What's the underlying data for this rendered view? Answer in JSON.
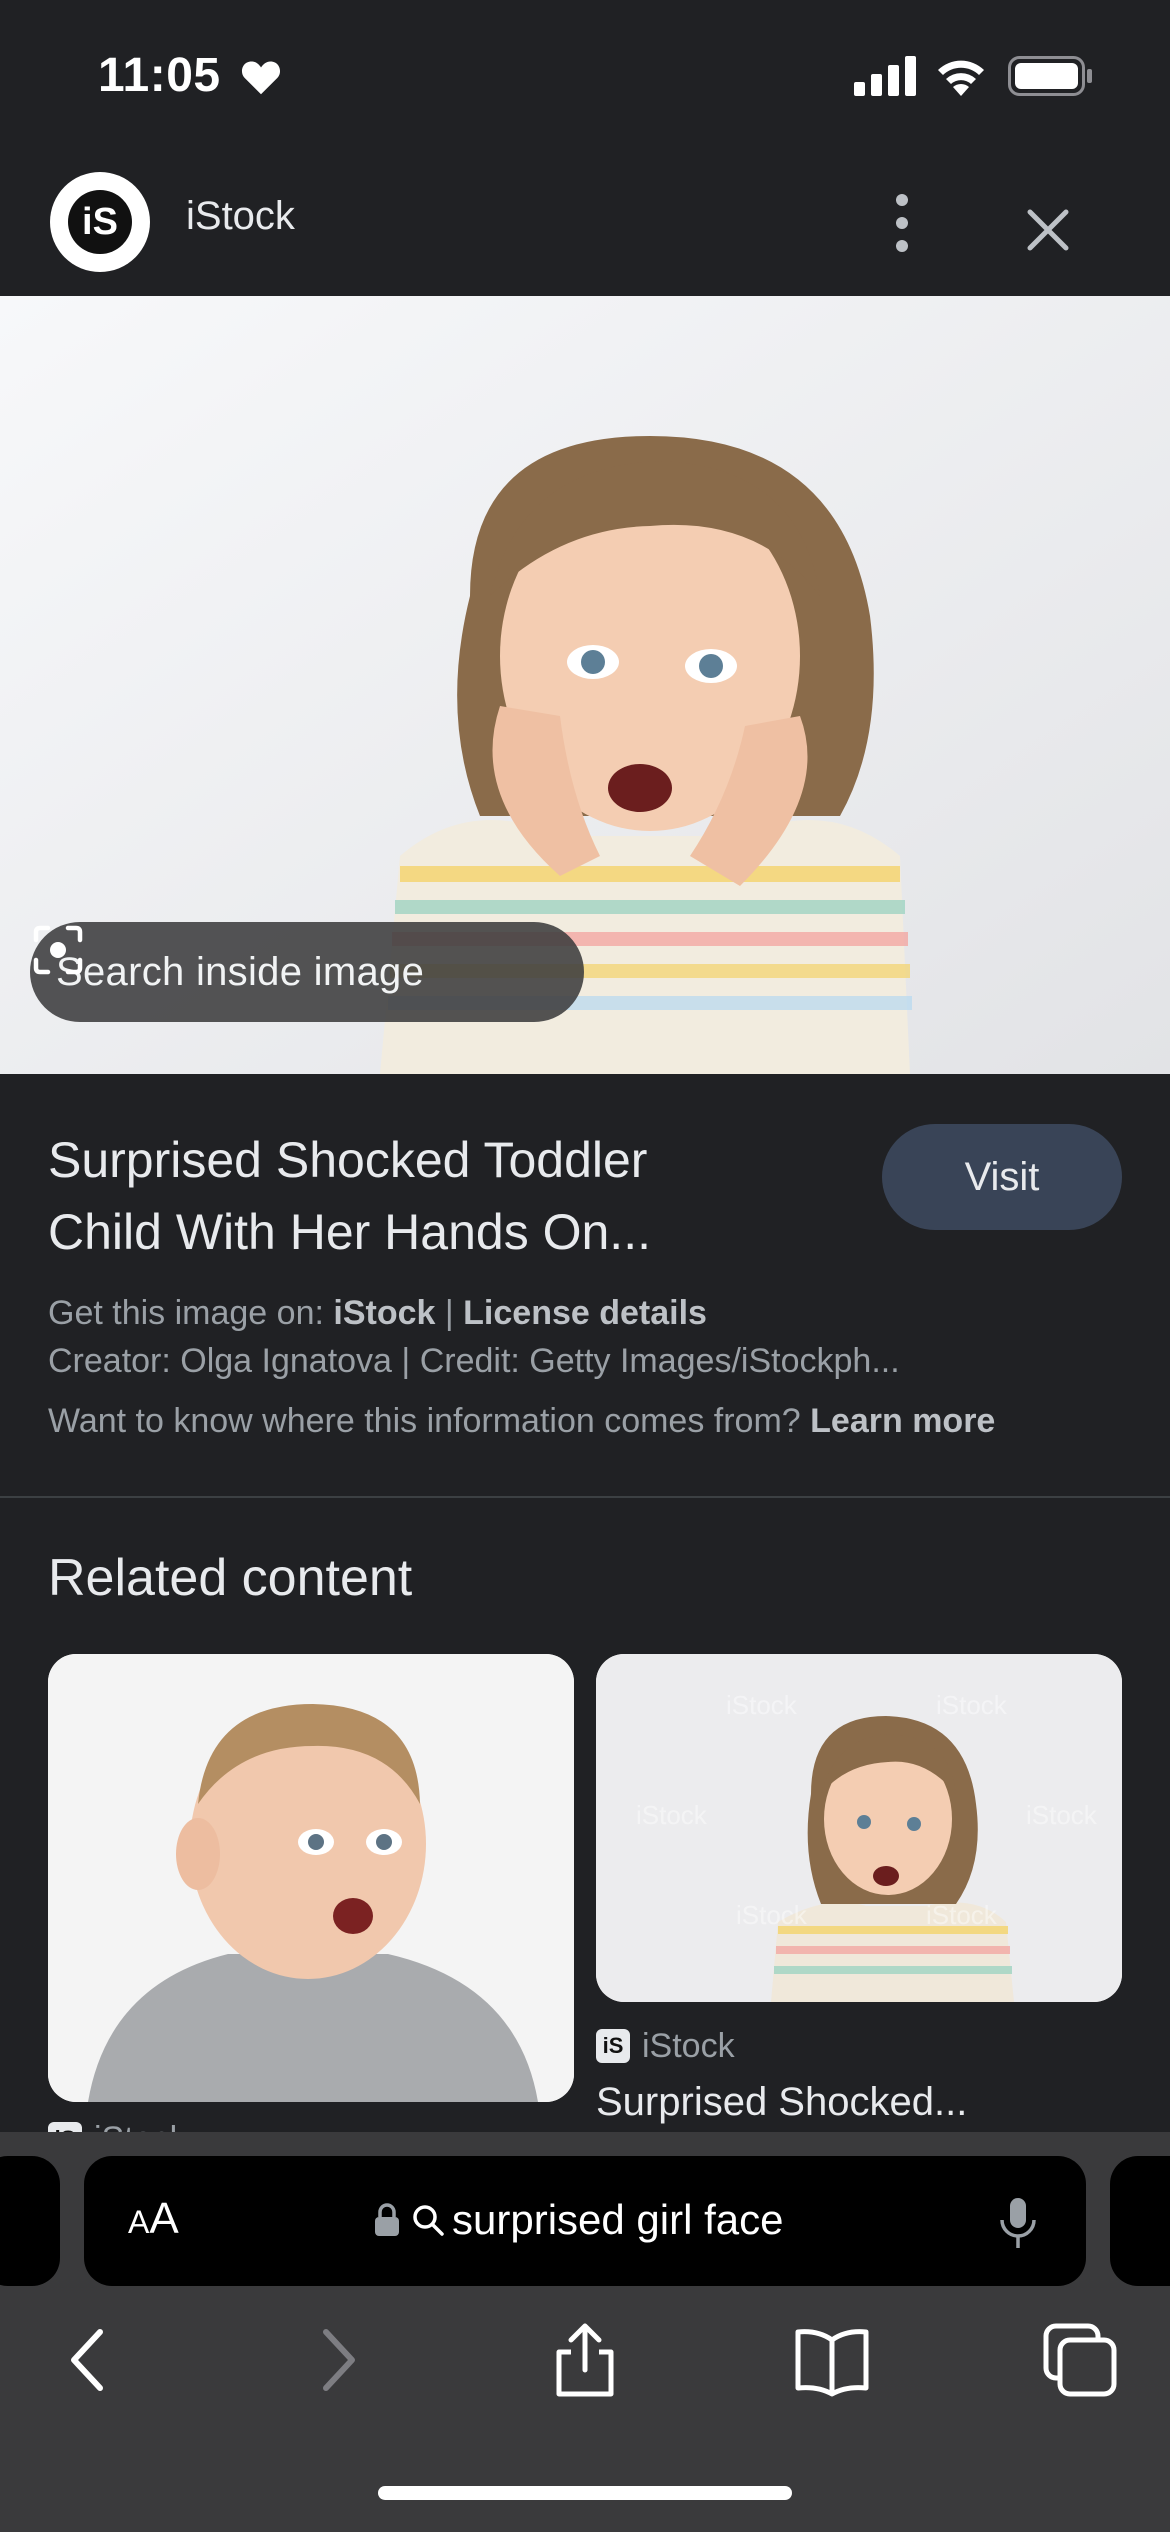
{
  "status_bar": {
    "time": "11:05"
  },
  "source": {
    "name": "iStock",
    "logo_text": "iS"
  },
  "main_image": {
    "search_inside_label": "Search inside image"
  },
  "info": {
    "title_line1": "Surprised Shocked Toddler",
    "title_line2": "Child With Her Hands On...",
    "visit_label": "Visit",
    "get_image_prefix": "Get this image on: ",
    "get_image_source": "iStock",
    "separator": " | ",
    "license_label": "License details",
    "creator_line": "Creator: Olga Ignatova | Credit: Getty Images/iStockph...",
    "info_question": "Want to know where this information comes from? ",
    "learn_more_label": "Learn more"
  },
  "related": {
    "heading": "Related content",
    "items": [
      {
        "source": "iStock"
      },
      {
        "source": "iStock",
        "title": "Surprised Shocked..."
      }
    ]
  },
  "toolbar": {
    "aa_small": "A",
    "aa_large": "A",
    "address_text": "surprised girl face"
  }
}
